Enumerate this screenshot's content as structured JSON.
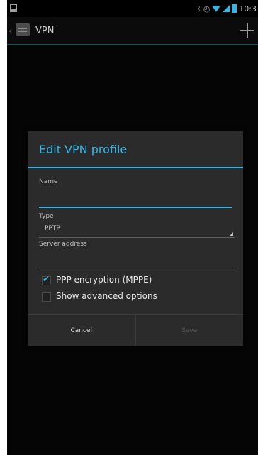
{
  "status_bar": {
    "time": "10:3"
  },
  "action_bar": {
    "back_glyph": "‹",
    "title": "VPN"
  },
  "dialog": {
    "title": "Edit VPN profile",
    "fields": {
      "name_label": "Name",
      "name_value": "",
      "type_label": "Type",
      "type_value": "PPTP",
      "server_label": "Server address",
      "server_value": ""
    },
    "options": {
      "ppp_label": "PPP encryption (MPPE)",
      "ppp_checked": true,
      "advanced_label": "Show advanced options",
      "advanced_checked": false
    },
    "buttons": {
      "cancel": "Cancel",
      "save": "Save"
    }
  },
  "colors": {
    "accent": "#33b5e5",
    "background": "#050505",
    "dialog_background": "#2b2b2b"
  },
  "icons": {
    "status_left": "notification-icon",
    "status_right": [
      "bluetooth-icon",
      "alarm-icon",
      "wifi-icon",
      "signal-icon",
      "battery-icon"
    ],
    "action_bar": [
      "back-icon",
      "settings-app-icon",
      "add-icon"
    ]
  }
}
